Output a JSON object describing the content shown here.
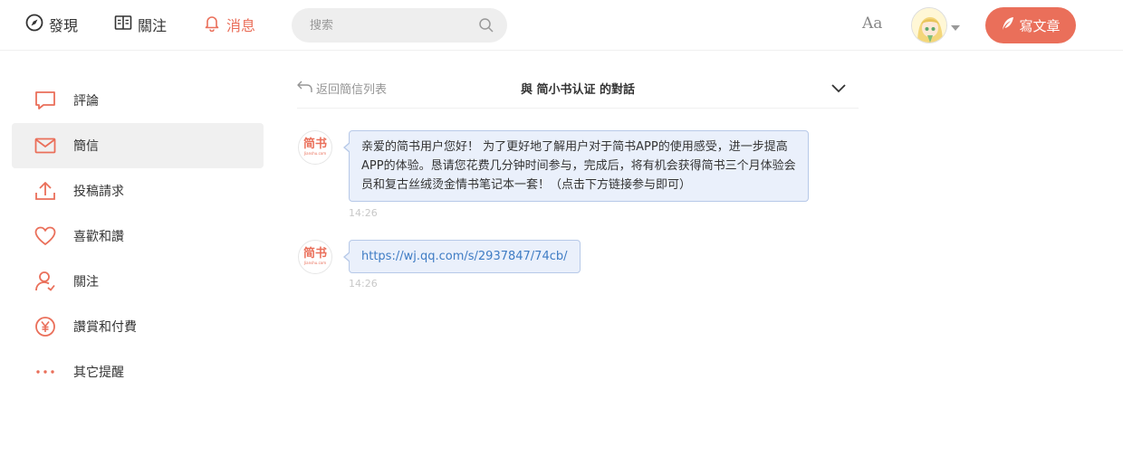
{
  "nav": {
    "discover": "發現",
    "follow": "關注",
    "messages": "消息",
    "search_placeholder": "搜索",
    "font_toggle": "Aa",
    "write_button": "寫文章"
  },
  "sidebar": {
    "items": [
      {
        "label": "評論",
        "icon": "comment-icon"
      },
      {
        "label": "簡信",
        "icon": "mail-icon"
      },
      {
        "label": "投稿請求",
        "icon": "upload-icon"
      },
      {
        "label": "喜歡和讚",
        "icon": "heart-icon"
      },
      {
        "label": "關注",
        "icon": "user-follow-icon"
      },
      {
        "label": "讚賞和付費",
        "icon": "yen-icon"
      },
      {
        "label": "其它提醒",
        "icon": "more-icon"
      }
    ],
    "active_index": 1
  },
  "chat": {
    "back_label": "返回簡信列表",
    "title": "與 简小书认证 的對話",
    "avatar_logo": "简书",
    "avatar_logo_sub": "Jianshu.com",
    "messages": [
      {
        "text": "亲爱的简书用户您好！ 为了更好地了解用户对于简书APP的使用感受，进一步提高APP的体验。恳请您花费几分钟时间参与，完成后，将有机会获得简书三个月体验会员和复古丝绒烫金情书笔记本一套！（点击下方链接参与即可）",
        "time": "14:26"
      },
      {
        "link": "https://wj.qq.com/s/2937847/74cb/",
        "time": "14:26"
      }
    ]
  },
  "colors": {
    "accent": "#ea6f5a",
    "bubble_bg": "#eaf0fb",
    "bubble_border": "#b7c9e8",
    "link": "#3f7cc4"
  }
}
